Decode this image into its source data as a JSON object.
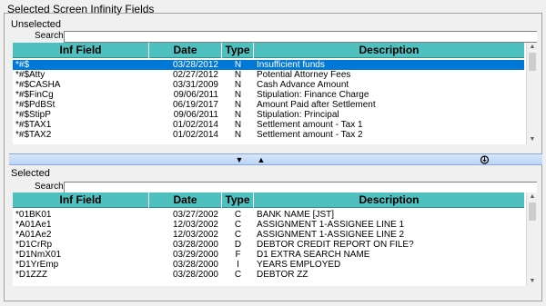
{
  "window": {
    "title": "Selected Screen Infinity Fields"
  },
  "unselected": {
    "title": "Unselected",
    "search_label": "Search",
    "search_value": "",
    "columns": [
      "Inf Field",
      "Date",
      "Type",
      "Description"
    ],
    "rows": [
      {
        "field": "*#$",
        "date": "03/28/2012",
        "type": "N",
        "desc": "Insufficient funds",
        "selected": true
      },
      {
        "field": "*#$Atty",
        "date": "02/27/2012",
        "type": "N",
        "desc": "Potential Attorney Fees"
      },
      {
        "field": "*#$CASHA",
        "date": "03/31/2009",
        "type": "N",
        "desc": "Cash Advance Amount"
      },
      {
        "field": "*#$FinCg",
        "date": "09/06/2011",
        "type": "N",
        "desc": "Stipulation: Finance Charge"
      },
      {
        "field": "*#$PdBSt",
        "date": "06/19/2017",
        "type": "N",
        "desc": "Amount Paid after Settlement"
      },
      {
        "field": "*#$StipP",
        "date": "09/06/2011",
        "type": "N",
        "desc": "Stipulation: Principal"
      },
      {
        "field": "*#$TAX1",
        "date": "01/02/2014",
        "type": "N",
        "desc": "Settlement amount - Tax 1"
      },
      {
        "field": "*#$TAX2",
        "date": "01/02/2014",
        "type": "N",
        "desc": "Settlement amount - Tax 2"
      }
    ]
  },
  "splitter": {
    "move_down_icon": "triangle-down",
    "move_up_icon": "triangle-up",
    "refresh_icon": "eye-refresh"
  },
  "selected": {
    "title": "Selected",
    "search_label": "Search",
    "search_value": "",
    "columns": [
      "Inf Field",
      "Date",
      "Type",
      "Description"
    ],
    "rows": [
      {
        "field": "*01BK01",
        "date": "03/27/2002",
        "type": "C",
        "desc": "BANK NAME [JST]"
      },
      {
        "field": "*A01Ae1",
        "date": "12/03/2002",
        "type": "C",
        "desc": "ASSIGNMENT 1-ASSIGNEE LINE 1"
      },
      {
        "field": "*A01Ae2",
        "date": "12/03/2002",
        "type": "C",
        "desc": "ASSIGNMENT 1-ASSIGNEE LINE 2"
      },
      {
        "field": "*D1CrRp",
        "date": "03/28/2000",
        "type": "D",
        "desc": "DEBTOR CREDIT REPORT ON FILE?"
      },
      {
        "field": "*D1NmX01",
        "date": "03/29/2000",
        "type": "F",
        "desc": "D1 EXTRA SEARCH NAME"
      },
      {
        "field": "*D1YrEmp",
        "date": "03/28/2000",
        "type": "I",
        "desc": "YEARS EMPLOYED"
      },
      {
        "field": "*D1ZZZ",
        "date": "03/28/2000",
        "type": "C",
        "desc": "DEBTOR ZZ"
      }
    ]
  }
}
